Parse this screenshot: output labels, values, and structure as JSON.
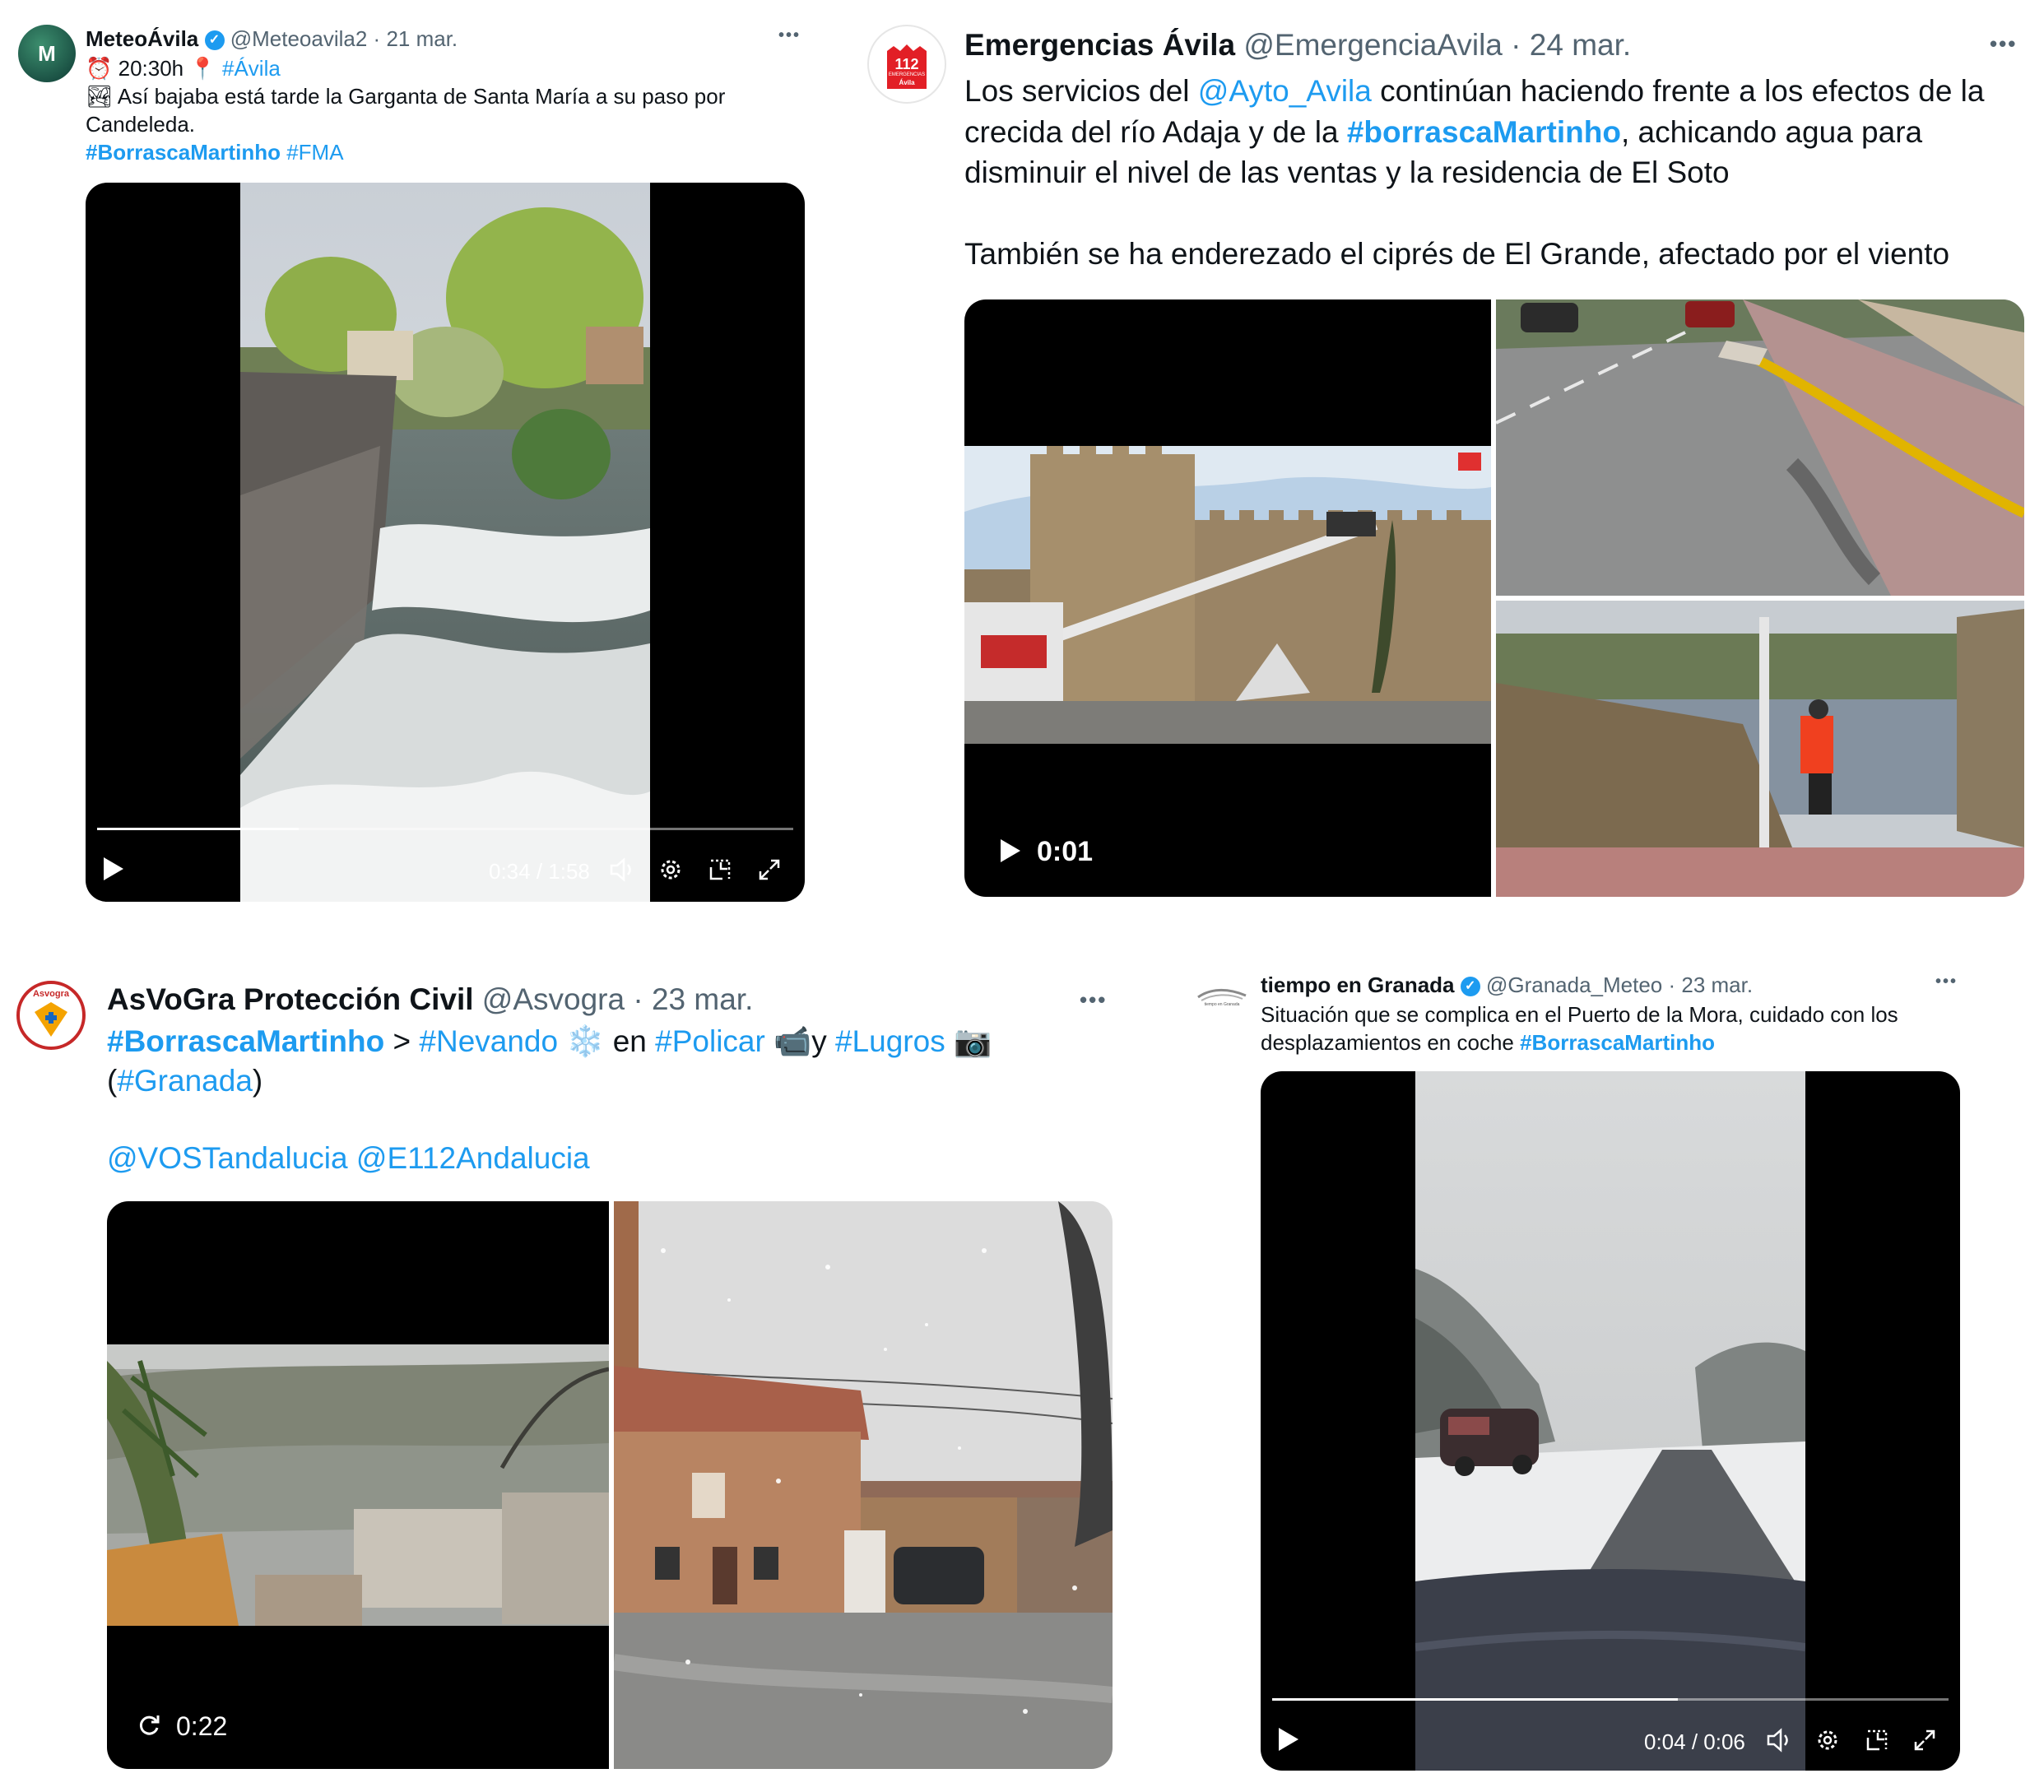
{
  "tweets": [
    {
      "name": "MeteoÁvila",
      "avatar_text": "M",
      "handle": "@Meteoavila2",
      "date": "21 mar.",
      "line1_emoji_time": "⏰",
      "line1_time": "20:30h",
      "line1_pin": "📍",
      "line1_tag": "#Ávila",
      "line2_emoji": "🏞",
      "line2": " Así bajaba está tarde  la Garganta de Santa María a su paso por",
      "line3": "Candeleda.",
      "tag1": "#BorrascaMartinho",
      "tag2": "#FMA",
      "video_time": "0:34 / 1:58",
      "progress": 0.29
    },
    {
      "name": "Emergencias Ávila",
      "avatar_text": "112",
      "avatar_sub": "EMERGENCIAS",
      "avatar_sub2": "Ávila",
      "handle": "@EmergenciaAvila",
      "date": "24 mar.",
      "t1": "Los servicios del ",
      "mention": "@Ayto_Avila",
      "t2": " continúan haciendo frente a los efectos de la",
      "t3": "crecida del río Adaja y de la ",
      "tag": "#borrascaMartinho",
      "t4": ", achicando agua para",
      "t5": "disminuir el nivel de las ventas y la residencia de El Soto",
      "t6": "También se ha enderezado el ciprés de El Grande, afectado por el viento",
      "video_time": "0:01"
    },
    {
      "name": "AsVoGra Protección Civil",
      "avatar_text": "Asvogra",
      "handle": "@Asvogra",
      "date": "23 mar.",
      "tag1": "#BorrascaMartinho",
      "gt": " > ",
      "tag2": "#Nevando",
      "snow": " ❄️ ",
      "en": "en ",
      "tag3": "#Policar",
      "cam": " 📹",
      "y": "y ",
      "tag4": "#Lugros",
      "photo": " 📷",
      "open": "(",
      "tag5": "#Granada",
      "close": ")",
      "mention1": "@VOSTandalucia",
      "mention2": "@E112Andalucia",
      "video_time": "0:22"
    },
    {
      "name": "tiempo en Granada",
      "avatar_text": "tiempo en Granada",
      "handle": "@Granada_Meteo",
      "date": "23 mar.",
      "t1": "Situación que se complica en el Puerto de la Mora, cuidado con los",
      "t2": "desplazamientos en coche ",
      "tag": "#BorrascaMartinho",
      "video_time": "0:04 / 0:06",
      "progress": 0.6
    }
  ],
  "icons": {
    "verified": "verified-badge-icon",
    "more": "more-options-icon",
    "play": "play-icon",
    "volume": "volume-icon",
    "settings": "gear-icon",
    "dock": "picture-in-picture-icon",
    "fullscreen": "fullscreen-icon",
    "replay": "replay-icon"
  },
  "colors": {
    "link": "#1d9bf0",
    "secondary": "#536471",
    "text": "#0f1419"
  },
  "separator": " · ",
  "more_label": "•••"
}
